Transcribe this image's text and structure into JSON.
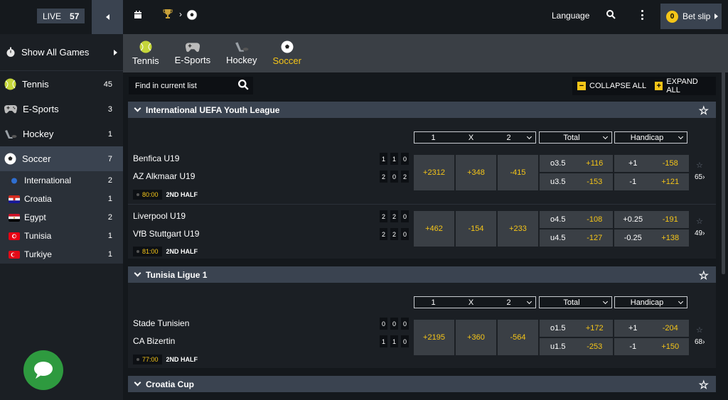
{
  "topbar": {
    "live_label": "LIVE",
    "live_count": "57",
    "trophy_icon": "trophy-icon",
    "language": "Language",
    "betslip_count": "0",
    "betslip_label": "Bet slip"
  },
  "sidebar": {
    "show_all": "Show All Games",
    "sports": [
      {
        "label": "Tennis",
        "count": "45"
      },
      {
        "label": "E-Sports",
        "count": "3"
      },
      {
        "label": "Hockey",
        "count": "1"
      },
      {
        "label": "Soccer",
        "count": "7"
      }
    ],
    "countries": [
      {
        "label": "International",
        "count": "2"
      },
      {
        "label": "Croatia",
        "count": "1"
      },
      {
        "label": "Egypt",
        "count": "2"
      },
      {
        "label": "Tunisia",
        "count": "1"
      },
      {
        "label": "Turkiye",
        "count": "1"
      }
    ]
  },
  "tabs": [
    "Tennis",
    "E-Sports",
    "Hockey",
    "Soccer"
  ],
  "tools": {
    "find_placeholder": "Find in current list",
    "collapse": "COLLAPSE ALL",
    "expand": "EXPAND ALL"
  },
  "markets": {
    "m1": "1",
    "mx": "X",
    "m2": "2",
    "total": "Total",
    "handicap": "Handicap"
  },
  "leagues": [
    {
      "name": "International UEFA Youth League"
    },
    {
      "name": "Tunisia Ligue 1"
    },
    {
      "name": "Croatia Cup"
    }
  ],
  "matches": [
    {
      "home": "Benfica U19",
      "away": "AZ Alkmaar U19",
      "home_score": [
        "1",
        "1",
        "0"
      ],
      "away_score": [
        "2",
        "0",
        "2"
      ],
      "time": "80:00",
      "half": "2ND HALF",
      "o1": "+2312",
      "ox": "+348",
      "o2": "-415",
      "t_over": "o3.5",
      "t_over_odd": "+116",
      "t_under": "u3.5",
      "t_under_odd": "-153",
      "h1": "+1",
      "h1_odd": "-158",
      "h2": "-1",
      "h2_odd": "+121",
      "more": "65"
    },
    {
      "home": "Liverpool U19",
      "away": "VfB Stuttgart U19",
      "home_score": [
        "2",
        "2",
        "0"
      ],
      "away_score": [
        "2",
        "2",
        "0"
      ],
      "time": "81:00",
      "half": "2ND HALF",
      "o1": "+462",
      "ox": "-154",
      "o2": "+233",
      "t_over": "o4.5",
      "t_over_odd": "-108",
      "t_under": "u4.5",
      "t_under_odd": "-127",
      "h1": "+0.25",
      "h1_odd": "-191",
      "h2": "-0.25",
      "h2_odd": "+138",
      "more": "49"
    },
    {
      "home": "Stade Tunisien",
      "away": "CA Bizertin",
      "home_score": [
        "0",
        "0",
        "0"
      ],
      "away_score": [
        "1",
        "1",
        "0"
      ],
      "time": "77:00",
      "half": "2ND HALF",
      "o1": "+2195",
      "ox": "+360",
      "o2": "-564",
      "t_over": "o1.5",
      "t_over_odd": "+172",
      "t_under": "u1.5",
      "t_under_odd": "-253",
      "h1": "+1",
      "h1_odd": "-204",
      "h2": "-1",
      "h2_odd": "+150",
      "more": "68"
    }
  ],
  "colors": {
    "accent": "#f5c518",
    "chat": "#2e9a3f"
  }
}
